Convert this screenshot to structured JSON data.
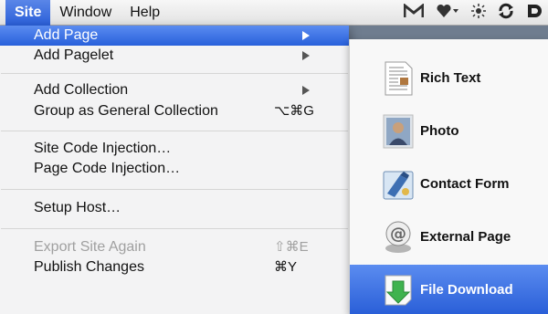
{
  "menubar": {
    "items": [
      "Site",
      "Window",
      "Help"
    ],
    "extra_icons": [
      "gmail-icon",
      "heart-dropdown-icon",
      "brightness-icon",
      "sync-icon",
      "dropbox-icon"
    ]
  },
  "site_menu": {
    "items": [
      {
        "label": "Add Page",
        "submenu": true,
        "highlighted": true
      },
      {
        "label": "Add Pagelet",
        "submenu": true
      },
      {
        "label": "Add Collection",
        "submenu": true
      },
      {
        "label": "Group as General Collection",
        "shortcut": "⌥⌘G"
      },
      {
        "label": "Site Code Injection…"
      },
      {
        "label": "Page Code Injection…"
      },
      {
        "label": "Setup Host…"
      },
      {
        "label": "Export Site Again",
        "shortcut": "⇧⌘E",
        "disabled": true
      },
      {
        "label": "Publish Changes",
        "shortcut": "⌘Y"
      }
    ]
  },
  "add_page_submenu": {
    "items": [
      {
        "label": "Rich Text",
        "icon": "rich-text-icon"
      },
      {
        "label": "Photo",
        "icon": "photo-icon"
      },
      {
        "label": "Contact Form",
        "icon": "contact-form-icon"
      },
      {
        "label": "External Page",
        "icon": "external-page-icon"
      },
      {
        "label": "File Download",
        "icon": "file-download-icon",
        "highlighted": true
      }
    ]
  },
  "colors": {
    "highlight": "#2860db",
    "menubar_bg": "#ececec",
    "disabled_text": "#a0a0a0"
  }
}
